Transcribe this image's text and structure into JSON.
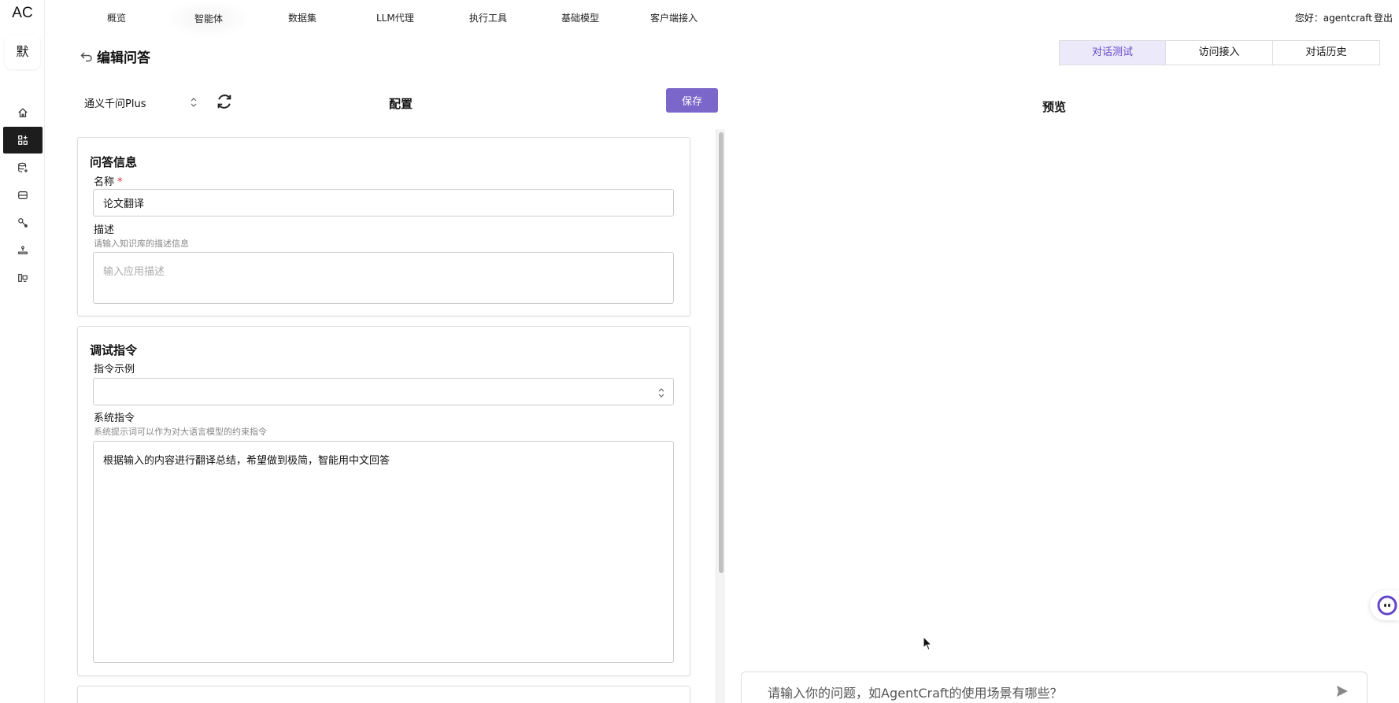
{
  "brand": "AC",
  "avatar_text": "默",
  "nav": {
    "items": [
      "概览",
      "智能体",
      "数据集",
      "LLM代理",
      "执行工具",
      "基础模型",
      "客户端接入"
    ],
    "active": "智能体",
    "greeting": "您好：agentcraft",
    "logout": "登出"
  },
  "sidebar": {
    "icons": [
      "home-icon",
      "agent-grid-icon",
      "dataset-add-icon",
      "storage-icon",
      "tool-icon",
      "model-icon",
      "client-icon"
    ],
    "active": "agent-grid-icon"
  },
  "header": {
    "title": "编辑问答",
    "tabs": [
      "对话测试",
      "访问接入",
      "对话历史"
    ],
    "active_tab": "对话测试"
  },
  "config": {
    "model": "通义千问Plus",
    "label": "配置",
    "save_label": "保存"
  },
  "qa_info": {
    "title": "问答信息",
    "name_label": "名称",
    "required_mark": "*",
    "name_value": "论文翻译",
    "desc_label": "描述",
    "desc_hint": "请输入知识库的描述信息",
    "desc_placeholder": "输入应用描述"
  },
  "debug": {
    "title": "调试指令",
    "example_label": "指令示例",
    "example_value": "",
    "system_label": "系统指令",
    "system_hint": "系统提示词可以作为对大语言模型的约束指令",
    "system_value": "根据输入的内容进行翻译总结，希望做到极简，智能用中文回答"
  },
  "preview": {
    "label": "预览",
    "input_placeholder": "请输入你的问题，如AgentCraft的使用场景有哪些？"
  },
  "colors": {
    "accent": "#7b66c9",
    "tab_active_bg": "#ece9fb",
    "tab_active_text": "#6547c9",
    "rail_active": "#1d1d1d"
  }
}
